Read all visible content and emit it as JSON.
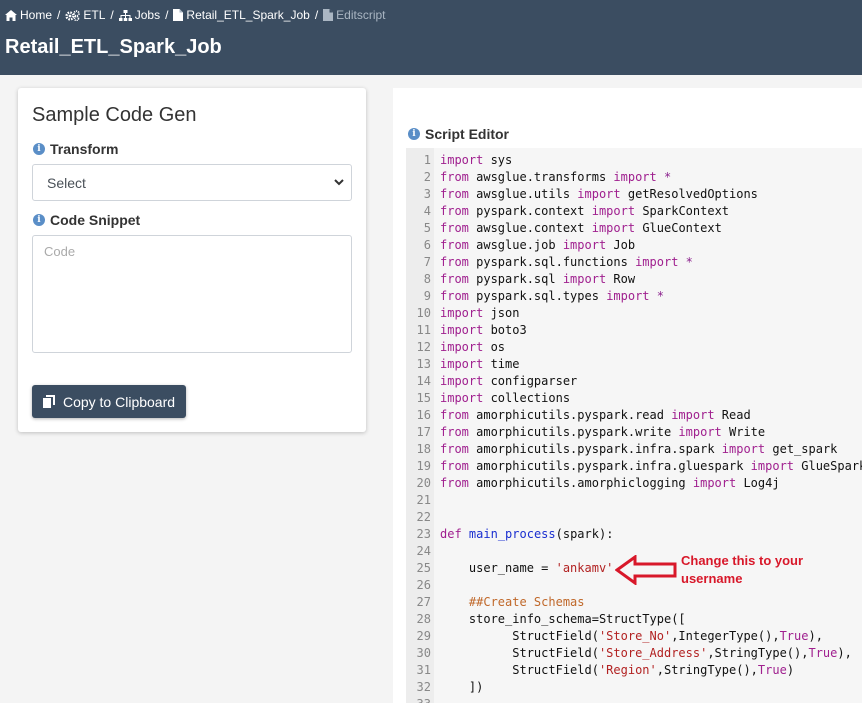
{
  "breadcrumb": {
    "items": [
      {
        "label": "Home",
        "icon": "home-icon"
      },
      {
        "label": "ETL",
        "icon": "gears-icon"
      },
      {
        "label": "Jobs",
        "icon": "sitemap-icon"
      },
      {
        "label": "Retail_ETL_Spark_Job",
        "icon": "file-icon"
      },
      {
        "label": "Editscript",
        "icon": "file-icon"
      }
    ],
    "separator": "/"
  },
  "header": {
    "title": "Retail_ETL_Spark_Job"
  },
  "codegen": {
    "title": "Sample Code Gen",
    "transform_label": "Transform",
    "transform_selected": "Select",
    "snippet_label": "Code Snippet",
    "snippet_placeholder": "Code",
    "copy_button": "Copy to Clipboard"
  },
  "editor": {
    "label": "Script Editor",
    "lines": [
      {
        "n": "1",
        "t": "import sys"
      },
      {
        "n": "2",
        "t": "from awsglue.transforms import *"
      },
      {
        "n": "3",
        "t": "from awsglue.utils import getResolvedOptions"
      },
      {
        "n": "4",
        "t": "from pyspark.context import SparkContext"
      },
      {
        "n": "5",
        "t": "from awsglue.context import GlueContext"
      },
      {
        "n": "6",
        "t": "from awsglue.job import Job"
      },
      {
        "n": "7",
        "t": "from pyspark.sql.functions import *"
      },
      {
        "n": "8",
        "t": "from pyspark.sql import Row"
      },
      {
        "n": "9",
        "t": "from pyspark.sql.types import *"
      },
      {
        "n": "10",
        "t": "import json"
      },
      {
        "n": "11",
        "t": "import boto3"
      },
      {
        "n": "12",
        "t": "import os"
      },
      {
        "n": "13",
        "t": "import time"
      },
      {
        "n": "14",
        "t": "import configparser"
      },
      {
        "n": "15",
        "t": "import collections"
      },
      {
        "n": "16",
        "t": "from amorphicutils.pyspark.read import Read"
      },
      {
        "n": "17",
        "t": "from amorphicutils.pyspark.write import Write"
      },
      {
        "n": "18",
        "t": "from amorphicutils.pyspark.infra.spark import get_spark"
      },
      {
        "n": "19",
        "t": "from amorphicutils.pyspark.infra.gluespark import GlueSpark"
      },
      {
        "n": "20",
        "t": "from amorphicutils.amorphiclogging import Log4j"
      },
      {
        "n": "21",
        "t": ""
      },
      {
        "n": "22",
        "t": ""
      },
      {
        "n": "23",
        "t": "def main_process(spark):"
      },
      {
        "n": "24",
        "t": ""
      },
      {
        "n": "25",
        "t": "    user_name = 'ankamv'"
      },
      {
        "n": "26",
        "t": ""
      },
      {
        "n": "27",
        "t": "    ##Create Schemas"
      },
      {
        "n": "28",
        "t": "    store_info_schema=StructType(["
      },
      {
        "n": "29",
        "t": "          StructField('Store_No',IntegerType(),True),"
      },
      {
        "n": "30",
        "t": "          StructField('Store_Address',StringType(),True),"
      },
      {
        "n": "31",
        "t": "          StructField('Region',StringType(),True)"
      },
      {
        "n": "32",
        "t": "    ])"
      },
      {
        "n": "33",
        "t": ""
      }
    ]
  },
  "annotation": {
    "text": "Change this to your username",
    "color": "#d8182a"
  },
  "colors": {
    "header_bg": "#3b4d61",
    "keyword": "#a0208f",
    "string": "#b22222",
    "comment": "#c0682a",
    "function": "#1a2fd0"
  }
}
